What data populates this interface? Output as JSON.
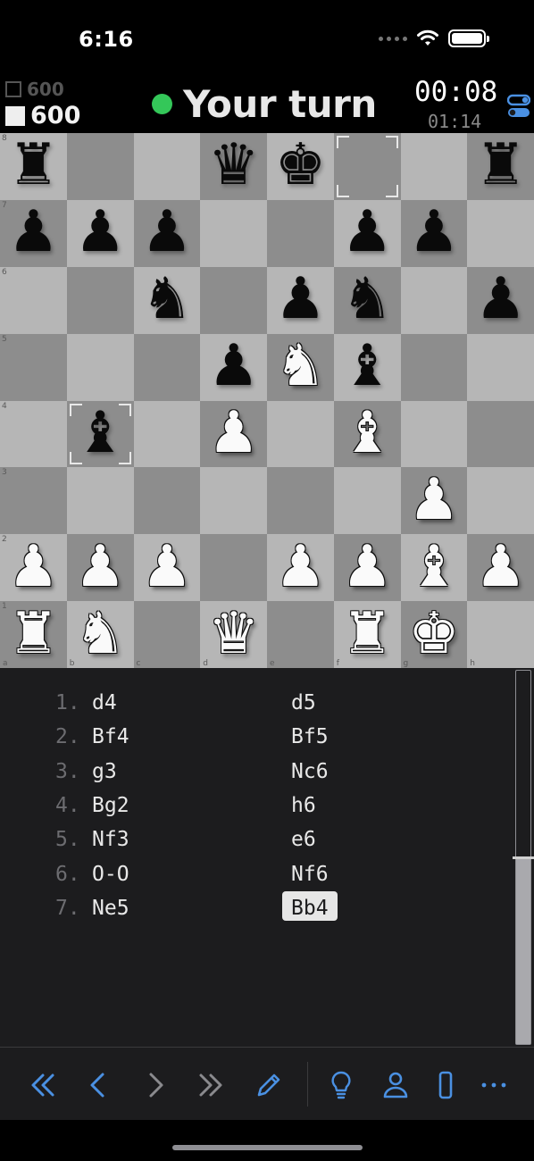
{
  "status_bar": {
    "time": "6:16",
    "icons": [
      "signal-dots-icon",
      "wifi-icon",
      "battery-icon"
    ]
  },
  "header": {
    "opponent_score": "600",
    "player_score": "600",
    "turn_text": "Your turn",
    "turn_indicator_color": "#34c759",
    "clock_main": "00:08",
    "clock_sub": "01:14"
  },
  "board": {
    "light_square_color": "#b6b6b6",
    "dark_square_color": "#8d8d8d",
    "files": [
      "a",
      "b",
      "c",
      "d",
      "e",
      "f",
      "g",
      "h"
    ],
    "ranks": [
      "8",
      "7",
      "6",
      "5",
      "4",
      "3",
      "2",
      "1"
    ],
    "position": [
      [
        "r",
        "",
        "",
        "q",
        "k",
        "",
        "",
        "r"
      ],
      [
        "p",
        "p",
        "p",
        "",
        "",
        "p",
        "p",
        ""
      ],
      [
        "",
        "",
        "n",
        "",
        "p",
        "n",
        "",
        "p"
      ],
      [
        "",
        "",
        "",
        "p",
        "N",
        "b",
        "",
        ""
      ],
      [
        "",
        "b",
        "",
        "P",
        "",
        "B",
        "",
        ""
      ],
      [
        "",
        "",
        "",
        "",
        "",
        "",
        "P",
        ""
      ],
      [
        "P",
        "P",
        "P",
        "",
        "P",
        "P",
        "B",
        "P"
      ],
      [
        "R",
        "N",
        "",
        "Q",
        "",
        "R",
        "K",
        ""
      ]
    ],
    "last_move_squares": [
      "f8",
      "b4"
    ]
  },
  "moves": [
    {
      "num": "1.",
      "white": "d4",
      "black": "d5"
    },
    {
      "num": "2.",
      "white": "Bf4",
      "black": "Bf5"
    },
    {
      "num": "3.",
      "white": "g3",
      "black": "Nc6"
    },
    {
      "num": "4.",
      "white": "Bg2",
      "black": "h6"
    },
    {
      "num": "5.",
      "white": "Nf3",
      "black": "e6"
    },
    {
      "num": "6.",
      "white": "O-O",
      "black": "Nf6"
    },
    {
      "num": "7.",
      "white": "Ne5",
      "black": "Bb4"
    }
  ],
  "current_move": "Bb4",
  "toolbar": {
    "accent_color": "#4a90e2",
    "buttons": [
      "first-move-icon",
      "previous-move-icon",
      "next-move-icon",
      "last-move-icon",
      "edit-pencil-icon",
      "hint-lightbulb-icon",
      "player-person-icon",
      "phone-device-icon",
      "more-dots-icon"
    ]
  }
}
